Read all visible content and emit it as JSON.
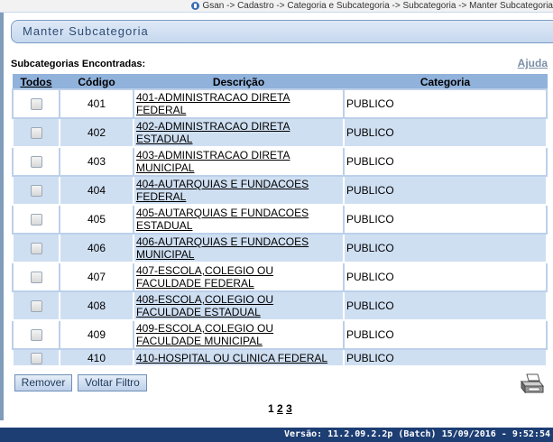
{
  "breadcrumb": "Gsan -> Cadastro -> Categoria e Subcategoria -> Subcategoria -> Manter Subcategoria",
  "page": {
    "title": "Manter Subcategoria",
    "found_label": "Subcategorias Encontradas:",
    "help": "Ajuda"
  },
  "table": {
    "headers": {
      "todos": "Todos",
      "codigo": "Código",
      "descricao": "Descrição",
      "categoria": "Categoria"
    },
    "rows": [
      {
        "codigo": "401",
        "descricao": "401-ADMINISTRACAO DIRETA FEDERAL",
        "categoria": "PUBLICO",
        "checked": false
      },
      {
        "codigo": "402",
        "descricao": "402-ADMINISTRACAO DIRETA ESTADUAL",
        "categoria": "PUBLICO",
        "checked": false
      },
      {
        "codigo": "403",
        "descricao": "403-ADMINISTRACAO DIRETA MUNICIPAL",
        "categoria": "PUBLICO",
        "checked": false
      },
      {
        "codigo": "404",
        "descricao": "404-AUTARQUIAS E FUNDACOES FEDERAL",
        "categoria": "PUBLICO",
        "checked": false
      },
      {
        "codigo": "405",
        "descricao": "405-AUTARQUIAS E FUNDACOES ESTADUAL",
        "categoria": "PUBLICO",
        "checked": false
      },
      {
        "codigo": "406",
        "descricao": "406-AUTARQUIAS E FUNDACOES MUNICIPAL",
        "categoria": "PUBLICO",
        "checked": false
      },
      {
        "codigo": "407",
        "descricao": "407-ESCOLA,COLEGIO OU FACULDADE FEDERAL",
        "categoria": "PUBLICO",
        "checked": false
      },
      {
        "codigo": "408",
        "descricao": "408-ESCOLA,COLEGIO OU FACULDADE ESTADUAL",
        "categoria": "PUBLICO",
        "checked": false
      },
      {
        "codigo": "409",
        "descricao": "409-ESCOLA,COLEGIO OU FACULDADE MUNICIPAL",
        "categoria": "PUBLICO",
        "checked": false
      },
      {
        "codigo": "410",
        "descricao": "410-HOSPITAL OU CLINICA FEDERAL",
        "categoria": "PUBLICO",
        "checked": false
      }
    ]
  },
  "buttons": {
    "remove": "Remover",
    "back": "Voltar Filtro"
  },
  "pagination": {
    "current": "1",
    "pages": [
      "2",
      "3"
    ]
  },
  "footer": "Versão: 11.2.09.2.2p (Batch) 15/09/2016 - 9:52:54",
  "icons": {
    "breadcrumb": "globe-icon",
    "print": "printer-icon"
  },
  "colors": {
    "header": "#90b2db",
    "row_alt": "#cfdff2",
    "footer": "#1d3e73"
  }
}
